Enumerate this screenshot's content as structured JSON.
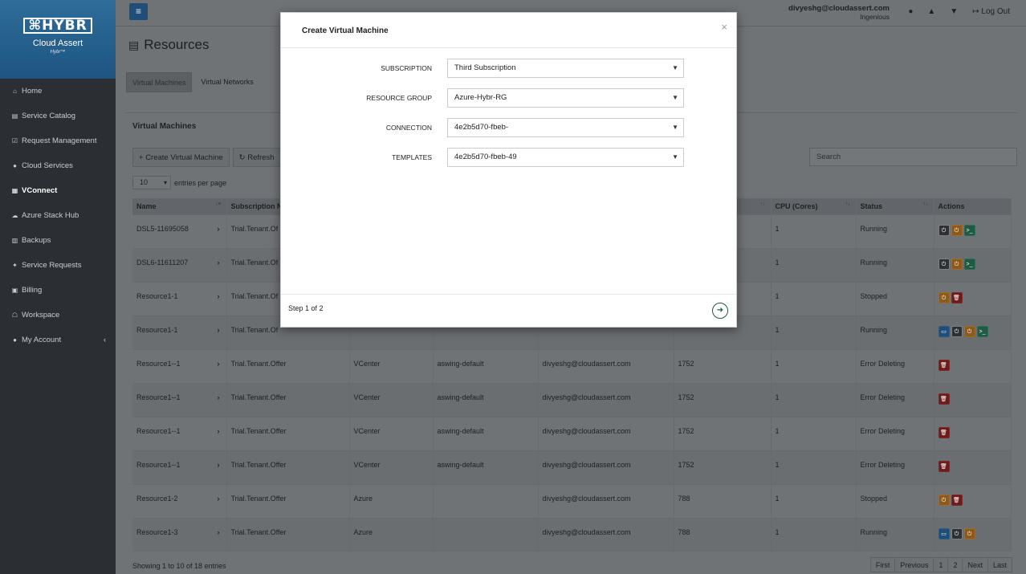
{
  "brand": {
    "logo": "HYBR",
    "name": "Cloud Assert",
    "sub": "Hybr™"
  },
  "sidebar": {
    "items": [
      {
        "label": "Home",
        "icon": "⌂"
      },
      {
        "label": "Service Catalog",
        "icon": "▤"
      },
      {
        "label": "Request Management",
        "icon": "☑"
      },
      {
        "label": "Cloud Services",
        "icon": "●"
      },
      {
        "label": "VConnect",
        "icon": "▦"
      },
      {
        "label": "Azure Stack Hub",
        "icon": "☁"
      },
      {
        "label": "Backups",
        "icon": "▥"
      },
      {
        "label": "Service Requests",
        "icon": "✦"
      },
      {
        "label": "Billing",
        "icon": "▣"
      },
      {
        "label": "Workspace",
        "icon": "☖"
      },
      {
        "label": "My Account",
        "icon": "●"
      }
    ]
  },
  "topbar": {
    "menu_icon": "≡",
    "user_email": "divyeshg@cloudassert.com",
    "user_org": "Ingenious",
    "logout": "Log Out"
  },
  "page": {
    "title": "Resources",
    "tabs": [
      "Virtual Machines",
      "Virtual Networks"
    ]
  },
  "panel": {
    "title": "Virtual Machines",
    "create_btn": "Create Virtual Machine",
    "refresh_btn": "Refresh",
    "entries_value": "10",
    "entries_label": "entries per page",
    "search_placeholder": "Search",
    "footer_info": "Showing 1 to 10 of 18 entries",
    "pager": [
      "First",
      "Previous",
      "1",
      "2",
      "Next",
      "Last"
    ]
  },
  "table": {
    "headers": [
      "Name",
      "Subscription N",
      "",
      "",
      "",
      "",
      "CPU (Cores)",
      "Status",
      "Actions"
    ],
    "rows": [
      {
        "name": "DSL5-11695058",
        "sub": "Trial.Tenant.Of",
        "c3": "",
        "c4": "",
        "c5": "",
        "c6": "",
        "cpu": "1",
        "status": "Running",
        "actions": [
          "gray",
          "orange",
          "green"
        ]
      },
      {
        "name": "DSL6-11611207",
        "sub": "Trial.Tenant.Of",
        "c3": "",
        "c4": "",
        "c5": "",
        "c6": "",
        "cpu": "1",
        "status": "Running",
        "actions": [
          "gray",
          "orange",
          "green"
        ]
      },
      {
        "name": "Resource1-1",
        "sub": "Trial.Tenant.Of",
        "c3": "",
        "c4": "",
        "c5": "",
        "c6": "",
        "cpu": "1",
        "status": "Stopped",
        "actions": [
          "orange",
          "red"
        ]
      },
      {
        "name": "Resource1-1",
        "sub": "Trial.Tenant.Of",
        "c3": "",
        "c4": "",
        "c5": "",
        "c6": "",
        "cpu": "1",
        "status": "Running",
        "actions": [
          "blue",
          "gray",
          "orange",
          "green"
        ]
      },
      {
        "name": "Resource1--1",
        "sub": "Trial.Tenant.Offer",
        "c3": "VCenter",
        "c4": "aswing-default",
        "c5": "divyeshg@cloudassert.com",
        "c6": "1752",
        "cpu": "1",
        "status": "Error Deleting",
        "actions": [
          "red"
        ]
      },
      {
        "name": "Resource1--1",
        "sub": "Trial.Tenant.Offer",
        "c3": "VCenter",
        "c4": "aswing-default",
        "c5": "divyeshg@cloudassert.com",
        "c6": "1752",
        "cpu": "1",
        "status": "Error Deleting",
        "actions": [
          "red"
        ]
      },
      {
        "name": "Resource1--1",
        "sub": "Trial.Tenant.Offer",
        "c3": "VCenter",
        "c4": "aswing-default",
        "c5": "divyeshg@cloudassert.com",
        "c6": "1752",
        "cpu": "1",
        "status": "Error Deleting",
        "actions": [
          "red"
        ]
      },
      {
        "name": "Resource1--1",
        "sub": "Trial.Tenant.Offer",
        "c3": "VCenter",
        "c4": "aswing-default",
        "c5": "divyeshg@cloudassert.com",
        "c6": "1752",
        "cpu": "1",
        "status": "Error Deleting",
        "actions": [
          "red"
        ]
      },
      {
        "name": "Resource1-2",
        "sub": "Trial.Tenant.Offer",
        "c3": "Azure",
        "c4": "",
        "c5": "divyeshg@cloudassert.com",
        "c6": "788",
        "cpu": "1",
        "status": "Stopped",
        "actions": [
          "orange",
          "red"
        ]
      },
      {
        "name": "Resource1-3",
        "sub": "Trial.Tenant.Offer",
        "c3": "Azure",
        "c4": "",
        "c5": "divyeshg@cloudassert.com",
        "c6": "788",
        "cpu": "1",
        "status": "Running",
        "actions": [
          "blue",
          "gray",
          "orange"
        ]
      }
    ]
  },
  "modal": {
    "title": "Create Virtual Machine",
    "close": "×",
    "fields": [
      {
        "label": "SUBSCRIPTION",
        "value": "Third Subscription"
      },
      {
        "label": "RESOURCE GROUP",
        "value": "Azure-Hybr-RG"
      },
      {
        "label": "CONNECTION",
        "value": "4e2b5d70-fbeb-"
      },
      {
        "label": "TEMPLATES",
        "value": "4e2b5d70-fbeb-49"
      }
    ],
    "step": "Step 1 of 2",
    "next_icon": "➜"
  }
}
